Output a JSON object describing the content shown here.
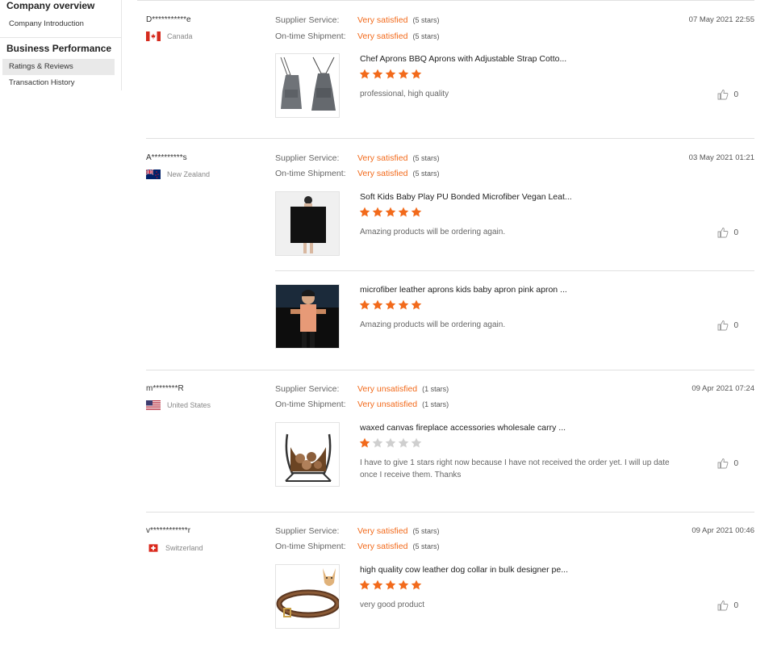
{
  "sidebar": {
    "company_overview": "Company overview",
    "company_intro": "Company Introduction",
    "business_performance": "Business Performance",
    "ratings_reviews": "Ratings & Reviews",
    "transaction_history": "Transaction History"
  },
  "labels": {
    "supplier_service": "Supplier Service:",
    "ontime_shipment": "On-time Shipment:"
  },
  "colors": {
    "accent": "#f26a1b",
    "star_empty": "#cfcfcf"
  },
  "reviews": [
    {
      "reviewer": "D***********e",
      "country": "Canada",
      "flag": "canada-flag",
      "date": "07 May 2021 22:55",
      "supplier_service": "Very satisfied",
      "supplier_stars": "(5 stars)",
      "shipment": "Very satisfied",
      "shipment_stars": "(5 stars)",
      "products": [
        {
          "name": "Chef Aprons BBQ Aprons with Adjustable Strap Cotto...",
          "rating": 5,
          "comment": "professional, high quality",
          "likes": "0",
          "image": "gray-apron-image"
        }
      ]
    },
    {
      "reviewer": "A**********s",
      "country": "New Zealand",
      "flag": "new-zealand-flag",
      "date": "03 May 2021 01:21",
      "supplier_service": "Very satisfied",
      "supplier_stars": "(5 stars)",
      "shipment": "Very satisfied",
      "shipment_stars": "(5 stars)",
      "products": [
        {
          "name": "Soft Kids Baby Play PU Bonded Microfiber Vegan Leat...",
          "rating": 5,
          "comment": "Amazing products will be ordering again.",
          "likes": "0",
          "image": "black-mat-image"
        },
        {
          "name": "microfiber leather aprons kids baby apron pink apron ...",
          "rating": 5,
          "comment": "Amazing products will be ordering again.",
          "likes": "0",
          "image": "kid-apron-image"
        }
      ]
    },
    {
      "reviewer": "m********R",
      "country": "United States",
      "flag": "usa-flag",
      "date": "09 Apr 2021 07:24",
      "supplier_service": "Very unsatisfied",
      "supplier_stars": "(1 stars)",
      "shipment": "Very unsatisfied",
      "shipment_stars": "(1 stars)",
      "products": [
        {
          "name": "waxed canvas fireplace accessories wholesale carry ...",
          "rating": 1,
          "comment": "I have to give 1 stars right now because I have not received the order yet.  I will up date once I receive them.  Thanks",
          "likes": "0",
          "image": "log-carrier-image"
        }
      ]
    },
    {
      "reviewer": "v************r",
      "country": "Switzerland",
      "flag": "switzerland-flag",
      "date": "09 Apr 2021 00:46",
      "supplier_service": "Very satisfied",
      "supplier_stars": "(5 stars)",
      "shipment": "Very satisfied",
      "shipment_stars": "(5 stars)",
      "products": [
        {
          "name": "high quality cow leather dog collar in bulk designer pe...",
          "rating": 5,
          "comment": "very good product",
          "likes": "0",
          "image": "dog-collar-image"
        }
      ]
    }
  ]
}
